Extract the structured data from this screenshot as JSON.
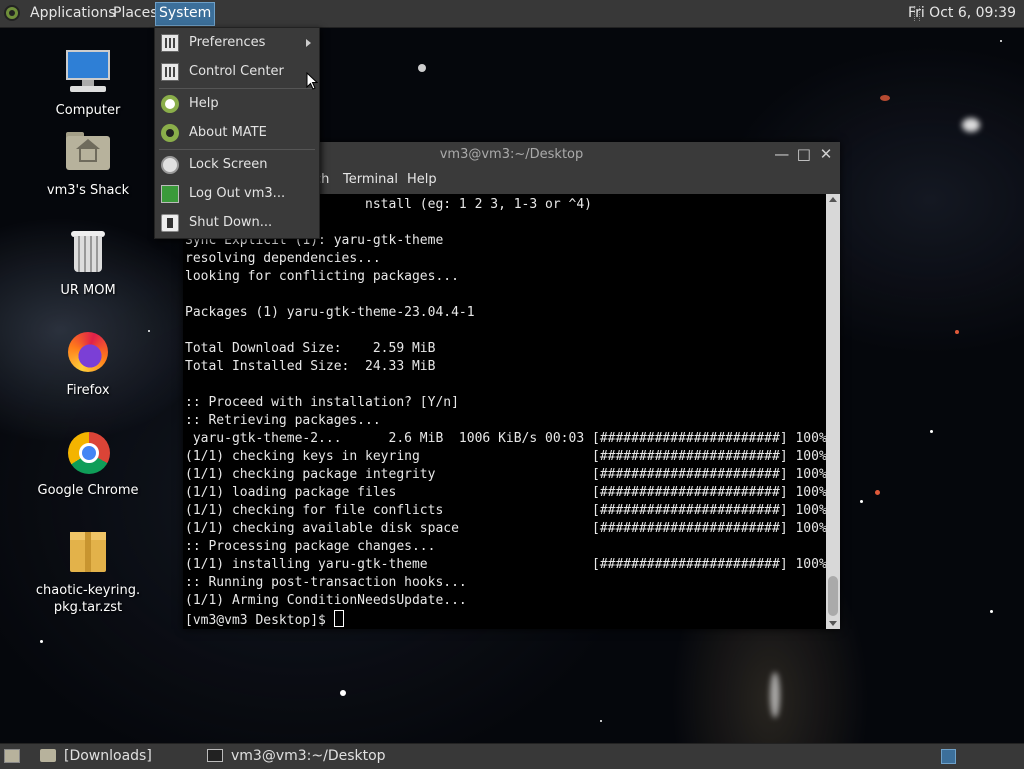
{
  "top_panel": {
    "menus": [
      "Applications",
      "Places",
      "System"
    ],
    "active_menu": "System",
    "clock": "Fri Oct  6, 09:39"
  },
  "desktop_icons": [
    {
      "label": "Computer",
      "icon": "computer-icon"
    },
    {
      "label": "vm3's Shack",
      "icon": "home-folder-icon"
    },
    {
      "label": "UR MOM",
      "icon": "trash-icon"
    },
    {
      "label": "Firefox",
      "icon": "firefox-icon"
    },
    {
      "label": "Google Chrome",
      "icon": "chrome-icon"
    },
    {
      "label": "chaotic-keyring.pkg.tar.zst",
      "icon": "package-icon"
    }
  ],
  "system_menu": {
    "items": [
      {
        "label": "Preferences",
        "icon": "preferences-icon",
        "submenu": true
      },
      {
        "label": "Control Center",
        "icon": "control-center-icon"
      },
      {
        "label": "Help",
        "icon": "help-icon"
      },
      {
        "label": "About MATE",
        "icon": "about-mate-icon"
      },
      {
        "label": "Lock Screen",
        "icon": "lock-icon"
      },
      {
        "label": "Log Out vm3...",
        "icon": "logout-icon"
      },
      {
        "label": "Shut Down...",
        "icon": "shutdown-icon"
      }
    ]
  },
  "terminal": {
    "title": "vm3@vm3:~/Desktop",
    "menubar": [
      "ch",
      "Terminal",
      "Help"
    ],
    "lines": [
      "                       nstall (eg: 1 2 3, 1-3 or ^4)",
      "",
      "Sync Explicit (1): yaru-gtk-theme",
      "resolving dependencies...",
      "looking for conflicting packages...",
      "",
      "Packages (1) yaru-gtk-theme-23.04.4-1",
      "",
      "Total Download Size:    2.59 MiB",
      "Total Installed Size:  24.33 MiB",
      "",
      ":: Proceed with installation? [Y/n]",
      ":: Retrieving packages...",
      " yaru-gtk-theme-2...      2.6 MiB  1006 KiB/s 00:03 [#######################] 100%",
      "(1/1) checking keys in keyring                      [#######################] 100%",
      "(1/1) checking package integrity                    [#######################] 100%",
      "(1/1) loading package files                         [#######################] 100%",
      "(1/1) checking for file conflicts                   [#######################] 100%",
      "(1/1) checking available disk space                 [#######################] 100%",
      ":: Processing package changes...",
      "(1/1) installing yaru-gtk-theme                     [#######################] 100%",
      ":: Running post-transaction hooks...",
      "(1/1) Arming ConditionNeedsUpdate..."
    ],
    "prompt": "[vm3@vm3 Desktop]$ "
  },
  "bottom_panel": {
    "tasks": [
      {
        "label": "[Downloads]",
        "icon": "folder-icon"
      },
      {
        "label": "vm3@vm3:~/Desktop",
        "icon": "terminal-icon"
      }
    ]
  }
}
